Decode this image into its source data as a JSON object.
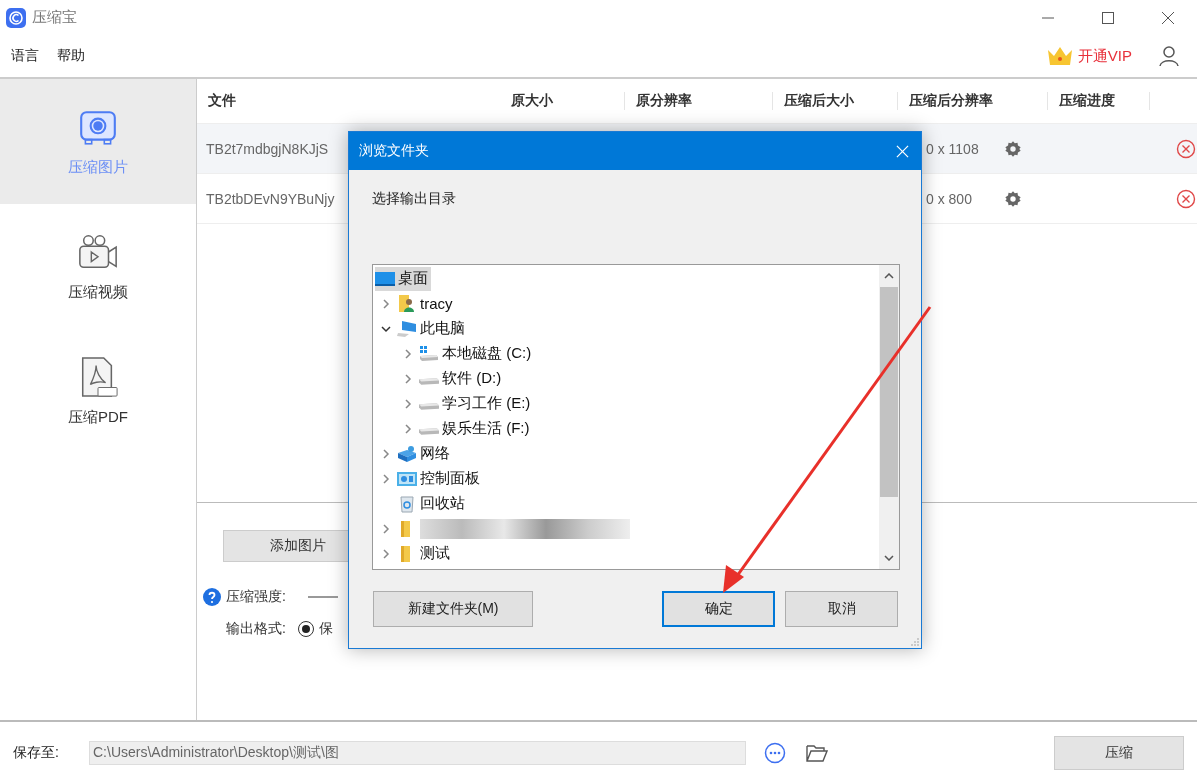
{
  "window": {
    "title": "压缩宝"
  },
  "menu": [
    "语言",
    "帮助"
  ],
  "vip": {
    "label": "开通VIP"
  },
  "sidebar": {
    "items": [
      {
        "label": "压缩图片",
        "kind": "image",
        "selected": true
      },
      {
        "label": "压缩视频",
        "kind": "video",
        "selected": false
      },
      {
        "label": "压缩PDF",
        "kind": "pdf",
        "selected": false
      }
    ]
  },
  "table": {
    "columns": [
      "文件",
      "原大小",
      "原分辨率",
      "压缩后大小",
      "压缩后分辨率",
      "压缩进度"
    ],
    "rows": [
      {
        "file": "TB2t7mdbgjN8KJjS",
        "resolution_after": "0 x 1108",
        "selected": true
      },
      {
        "file": "TB2tbDEvN9YBuNjy",
        "resolution_after": "0 x 800",
        "selected": false
      }
    ]
  },
  "controls": {
    "add_button": "添加图片",
    "strength_label": "压缩强度:",
    "format_label": "输出格式:",
    "format_options": [
      {
        "label": "保",
        "selected": true
      }
    ]
  },
  "dialog": {
    "title": "浏览文件夹",
    "prompt": "选择输出目录",
    "tree": [
      {
        "label": "桌面",
        "kind": "desktop",
        "selected": true,
        "expandable": false,
        "children": [
          {
            "label": "tracy",
            "kind": "user",
            "selected": false,
            "expandable": true,
            "expanded": false
          },
          {
            "label": "此电脑",
            "kind": "computer",
            "selected": false,
            "expandable": true,
            "expanded": true,
            "children": [
              {
                "label": "本地磁盘 (C:)",
                "kind": "system-drive",
                "selected": false,
                "expandable": true,
                "expanded": false
              },
              {
                "label": "软件 (D:)",
                "kind": "drive",
                "selected": false,
                "expandable": true,
                "expanded": false
              },
              {
                "label": "学习工作 (E:)",
                "kind": "drive",
                "selected": false,
                "expandable": true,
                "expanded": false
              },
              {
                "label": "娱乐生活 (F:)",
                "kind": "drive",
                "selected": false,
                "expandable": true,
                "expanded": false
              }
            ]
          },
          {
            "label": "网络",
            "kind": "network",
            "selected": false,
            "expandable": true,
            "expanded": false
          },
          {
            "label": "控制面板",
            "kind": "control-panel",
            "selected": false,
            "expandable": true,
            "expanded": false
          },
          {
            "label": "回收站",
            "kind": "recycle-bin",
            "selected": false,
            "expandable": false
          },
          {
            "kind": "folder",
            "redacted": true,
            "selected": false,
            "expandable": true,
            "expanded": false
          },
          {
            "label": "测试",
            "kind": "folder",
            "selected": false,
            "expandable": true,
            "expanded": false
          }
        ]
      }
    ],
    "buttons": [
      {
        "label": "新建文件夹(M)",
        "focused": false
      },
      {
        "label": "确定",
        "focused": true
      },
      {
        "label": "取消",
        "focused": false
      }
    ]
  },
  "footer": {
    "label": "保存至:",
    "path": "C:\\Users\\Administrator\\Desktop\\测试\\图",
    "compress_button": "压缩"
  }
}
